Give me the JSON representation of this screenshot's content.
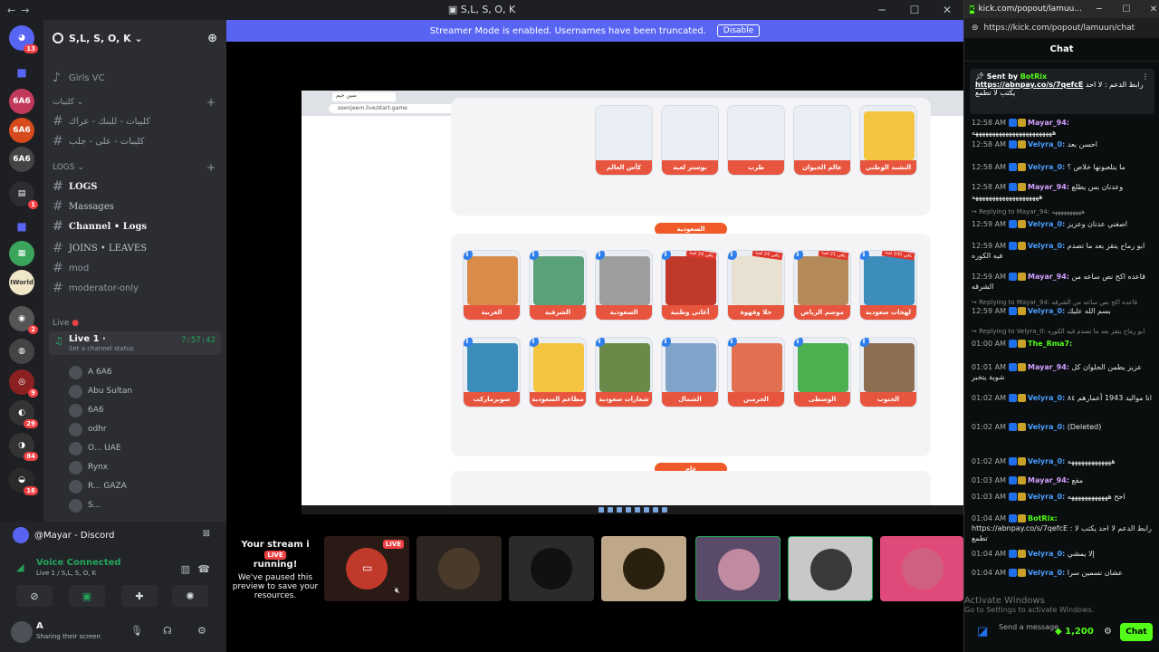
{
  "window": {
    "title": "S,L, S, O, K"
  },
  "banner": {
    "text": "Streamer Mode is enabled. Usernames have been truncated.",
    "button": "Disable"
  },
  "rail": {
    "badges": [
      "13",
      "1",
      "1",
      "2",
      "9",
      "29",
      "84",
      "16"
    ],
    "items": [
      "6A6",
      "6A6"
    ]
  },
  "server": {
    "name": "S,L, S, O, K",
    "channels": [
      {
        "label": "Girls VC",
        "type": "voice"
      },
      {
        "label": "كليبات",
        "type": "category"
      },
      {
        "label": "كليبات - للبنك - عراك",
        "type": "text"
      },
      {
        "label": "كليبات - على - جلب",
        "type": "text"
      },
      {
        "label": "LOGS",
        "type": "category"
      },
      {
        "label": "LOGS",
        "type": "text-bold"
      },
      {
        "label": "Massages",
        "type": "text-serif"
      },
      {
        "label": "Channel • Logs",
        "type": "text-bold"
      },
      {
        "label": "JOINS • LEAVES",
        "type": "text-serif"
      },
      {
        "label": "mod",
        "type": "text"
      },
      {
        "label": "moderator-only",
        "type": "text"
      },
      {
        "label": "Live",
        "type": "category"
      }
    ],
    "live_channel": {
      "name": "Live 1 ·",
      "sub": "Set a channel status",
      "time": "7:57:42"
    },
    "voice_users": [
      {
        "name": "A 6A6",
        "live": true
      },
      {
        "name": "Abu Sultan",
        "live": true
      },
      {
        "name": "6A6",
        "live": false
      },
      {
        "name": "odhr",
        "live": false
      },
      {
        "name": "O... UAE",
        "live": false
      },
      {
        "name": "Rynx",
        "live": false
      },
      {
        "name": "R... GAZA",
        "live": false
      },
      {
        "name": "S...",
        "live": false
      }
    ],
    "live_label": "LIVE"
  },
  "bottom": {
    "mayar": "@Mayar - Discord",
    "voice_connected": "Voice Connected",
    "voice_sub": "Live 1 / S,L, S, O, K",
    "user_name": "A",
    "user_status": "Sharing their screen"
  },
  "stream": {
    "tab": "سين جيم",
    "url": "seenjeem.live/start-game",
    "sections": [
      "السعودية",
      "عام"
    ],
    "row1": [
      "كأس العالم",
      "بوستر لعبة",
      "طرب",
      "عالم الحيوان",
      "النشيد الوطني"
    ],
    "row2": [
      "الغربية",
      "الشرقية",
      "السعودية",
      "أغاني وطنية",
      "حلا وقهوة",
      "موسم الرياض",
      "لهجات سعودية"
    ],
    "row3": [
      "سوبرماركت",
      "مطاعم السعودية",
      "شعارات سعودية",
      "الشمال",
      "الحرمين",
      "الوسطى",
      "الجنوب"
    ],
    "ribbons": [
      "باقي 24 لعبة",
      "باقي 24 لعبة",
      "باقي 21 لعبة",
      "باقي 100 لعبة"
    ]
  },
  "paused": {
    "title": "Your stream i",
    "running": "running!",
    "text": "We've paused this preview to save your resources.",
    "live": "LIVE"
  },
  "kick": {
    "title": "kick.com/popout/lamuu...",
    "url": "https://kick.com/popout/lamuun/chat",
    "header": "Chat",
    "pinned": {
      "sent": "Sent by",
      "bot": "BotRix",
      "link": "https://abnpay.co/s/7qefcE",
      "text": "رابط الدعم : لا احد يكتب لا تطمع"
    },
    "messages": [
      {
        "t": "12:58 AM",
        "u": "Mayar_94:",
        "c": "#d0a0ff",
        "m": "ههههههههههههههههههههههههه"
      },
      {
        "t": "12:58 AM",
        "u": "Velyra_0:",
        "c": "#4a9eff",
        "m": "احسن بعد"
      },
      {
        "t": "12:58 AM",
        "u": "Velyra_0:",
        "c": "#4a9eff",
        "m": "ما يتلعبونها خلاص ؟"
      },
      {
        "t": "12:58 AM",
        "u": "Mayar_94:",
        "c": "#d0a0ff",
        "m": "وعدنان بس يطلع ههههههههههههههههههههه"
      },
      {
        "t": "12:59 AM",
        "u": "Velyra_0:",
        "c": "#4a9eff",
        "m": "اصغني عدنان وعزيز"
      },
      {
        "t": "12:59 AM",
        "u": "Velyra_0:",
        "c": "#4a9eff",
        "m": "ابو رماح يتقز بعد ما تصدم فيه الكوره"
      },
      {
        "t": "12:59 AM",
        "u": "Mayar_94:",
        "c": "#d0a0ff",
        "m": "قاعده اكح نص ساعه من الشرقه"
      },
      {
        "t": "12:59 AM",
        "u": "Velyra_0:",
        "c": "#4a9eff",
        "m": "بسم الله عليك"
      },
      {
        "t": "01:00 AM",
        "u": "The_Rma7:",
        "c": "#53fc18",
        "m": ""
      },
      {
        "t": "01:01 AM",
        "u": "Mayar_94:",
        "c": "#d0a0ff",
        "m": "عزيز يطمن الحلوان كل شوية يتخبر"
      },
      {
        "t": "01:02 AM",
        "u": "Velyra_0:",
        "c": "#4a9eff",
        "m": "انا مواليد 1943 أعمارهم ٨٤"
      },
      {
        "t": "01:02 AM",
        "u": "Velyra_0:",
        "c": "#4a9eff",
        "m": "(Deleted)"
      },
      {
        "t": "01:02 AM",
        "u": "Velyra_0:",
        "c": "#4a9eff",
        "m": "هههههههههههههه"
      },
      {
        "t": "01:03 AM",
        "u": "Mayar_94:",
        "c": "#d0a0ff",
        "m": "مقع"
      },
      {
        "t": "01:03 AM",
        "u": "Velyra_0:",
        "c": "#4a9eff",
        "m": "احح ههههههههههههه"
      },
      {
        "t": "01:04 AM",
        "u": "BotRix:",
        "c": "#53fc18",
        "m": "https://abnpay.co/s/7qefcE : رابط الدعم لا احد يكتب لا تطمع"
      },
      {
        "t": "01:04 AM",
        "u": "Velyra_0:",
        "c": "#4a9eff",
        "m": "إلا يمشي"
      },
      {
        "t": "01:04 AM",
        "u": "Velyra_0:",
        "c": "#4a9eff",
        "m": "عشان نسمين سرا"
      }
    ],
    "replies": [
      "Replying to Mayar_94: ههههههههههه",
      "Replying to Mayar_94: قاعده اكح نص ساعه من الشرقه",
      "Replying to Velyra_0: ابو رماح يتقز بعد ما تصدم فيه الكوره"
    ],
    "send": "Send a message",
    "points": "1,200",
    "chat_btn": "Chat",
    "activate": "Activate Windows",
    "activate_sub": "Go to Settings to activate Windows."
  }
}
